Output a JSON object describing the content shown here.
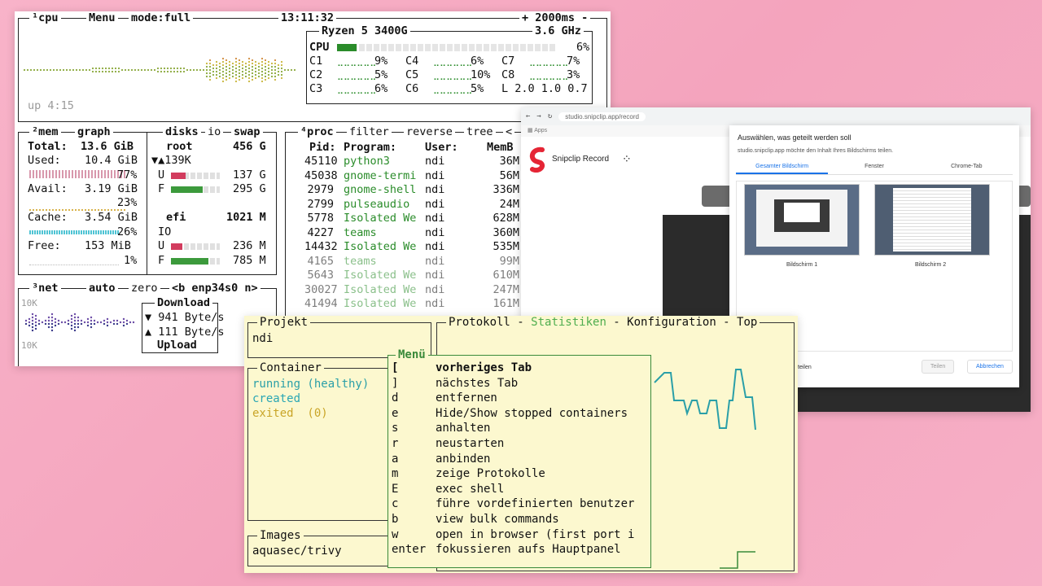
{
  "btop": {
    "cpu_box": {
      "title": "¹cpu",
      "menu": "Menu",
      "mode": "mode:full",
      "clock": "13:11:32",
      "rate": "+ 2000ms -",
      "uptime": "up 4:15",
      "cpu_name": "Ryzen 5 3400G",
      "freq": "3.6 GHz",
      "total_label": "CPU",
      "total_pct": "6%",
      "total_level": 0.06,
      "cores": [
        {
          "label": "C1",
          "pct": "9%"
        },
        {
          "label": "C2",
          "pct": "5%"
        },
        {
          "label": "C3",
          "pct": "6%"
        },
        {
          "label": "C4",
          "pct": "6%"
        },
        {
          "label": "C5",
          "pct": "10%"
        },
        {
          "label": "C6",
          "pct": "5%"
        },
        {
          "label": "C7",
          "pct": "7%"
        },
        {
          "label": "C8",
          "pct": "3%"
        }
      ],
      "load": "L 2.0 1.0 0.7"
    },
    "mem_box": {
      "title": "²mem",
      "graph_tab": "graph",
      "total": "Total:  13.6 GiB",
      "used_label": "Used:",
      "used_value": "10.4 GiB",
      "used_pct": "77%",
      "avail_label": "Avail:",
      "avail_value": "3.19 GiB",
      "avail_pct": "23%",
      "cache_label": "Cache:",
      "cache_value": "3.54 GiB",
      "cache_pct": "26%",
      "free_label": "Free:",
      "free_value": "153 MiB",
      "free_pct": "1%"
    },
    "disks_box": {
      "title": "disks",
      "io_tab": "io",
      "swap_tab": "swap",
      "root_name": "root",
      "root_size": "456 G",
      "root_io": "▼▲139K",
      "root_used_label": "U",
      "root_used": "137 G",
      "root_used_level": 0.3,
      "root_free_label": "F",
      "root_free": "295 G",
      "root_free_level": 0.65,
      "efi_name": "efi",
      "efi_size": "1021 M",
      "efi_io": "IO",
      "efi_used_label": "U",
      "efi_used": "236 M",
      "efi_used_level": 0.23,
      "efi_free_label": "F",
      "efi_free": "785 M",
      "efi_free_level": 0.77
    },
    "proc_box": {
      "title": "⁴proc",
      "filter_tab": "filter",
      "reverse_tab": "reverse",
      "tree_tab": "tree",
      "arrow": "<",
      "headers": {
        "pid": "Pid:",
        "program": "Program:",
        "user": "User:",
        "mem": "MemB"
      },
      "rows": [
        {
          "pid": "45110",
          "program": "python3",
          "user": "ndi",
          "mem": "36M"
        },
        {
          "pid": "45038",
          "program": "gnome-termi",
          "user": "ndi",
          "mem": "56M"
        },
        {
          "pid": "2979",
          "program": "gnome-shell",
          "user": "ndi",
          "mem": "336M"
        },
        {
          "pid": "2799",
          "program": "pulseaudio",
          "user": "ndi",
          "mem": "24M"
        },
        {
          "pid": "5778",
          "program": "Isolated We",
          "user": "ndi",
          "mem": "628M"
        },
        {
          "pid": "4227",
          "program": "teams",
          "user": "ndi",
          "mem": "360M"
        },
        {
          "pid": "14432",
          "program": "Isolated We",
          "user": "ndi",
          "mem": "535M"
        },
        {
          "pid": "4165",
          "program": "teams",
          "user": "ndi",
          "mem": "99M"
        },
        {
          "pid": "5643",
          "program": "Isolated We",
          "user": "ndi",
          "mem": "610M"
        },
        {
          "pid": "30027",
          "program": "Isolated We",
          "user": "ndi",
          "mem": "247M"
        },
        {
          "pid": "41494",
          "program": "Isolated We",
          "user": "ndi",
          "mem": "161M"
        }
      ]
    },
    "net_box": {
      "title": "³net",
      "auto_tab": "auto",
      "zero_tab": "zero",
      "iface": "<b enp34s0 n>",
      "scale_top": "10K",
      "scale_bottom": "10K",
      "download_label": "Download",
      "download_rate": "▼ 941 Byte/s",
      "upload_rate": "▲ 111 Byte/s",
      "upload_label": "Upload"
    }
  },
  "browser": {
    "url": "studio.snipclip.app/record",
    "bookmark": "Apps",
    "app_name": "Snipclip Record",
    "dialog": {
      "title": "Auswählen, was geteilt werden soll",
      "subtitle": "studio.snipclip.app möchte den Inhalt Ihres Bildschirms teilen.",
      "tabs": [
        "Gesamter Bildschirm",
        "Fenster",
        "Chrome-Tab"
      ],
      "screens": [
        "Bildschirm 1",
        "Bildschirm 2"
      ],
      "share_audio": "teilen",
      "share_button": "Teilen",
      "cancel_button": "Abbrechen"
    }
  },
  "lazydocker": {
    "project_title": "Projekt",
    "project_name": "ndi",
    "tabs_line": {
      "protokoll": "Protokoll",
      "statistiken": "Statistiken",
      "konfiguration": "Konfiguration",
      "top": "Top",
      "sep": " - "
    },
    "container_title": "Container",
    "containers": [
      {
        "text": "running (healthy)",
        "state": "running"
      },
      {
        "text": "created",
        "state": "created"
      },
      {
        "text": "exited  (0)",
        "state": "exited"
      }
    ],
    "images_title": "Images",
    "images": [
      "aquasec/trivy"
    ],
    "menu_title": "Menü",
    "menu_items": [
      {
        "key": "[",
        "label": "vorheriges Tab"
      },
      {
        "key": "]",
        "label": "nächstes Tab"
      },
      {
        "key": "d",
        "label": "entfernen"
      },
      {
        "key": "e",
        "label": "Hide/Show stopped containers"
      },
      {
        "key": "s",
        "label": "anhalten"
      },
      {
        "key": "r",
        "label": "neustarten"
      },
      {
        "key": "a",
        "label": "anbinden"
      },
      {
        "key": "m",
        "label": "zeige Protokolle"
      },
      {
        "key": "E",
        "label": "exec shell"
      },
      {
        "key": "c",
        "label": "führe vordefinierten benutzer"
      },
      {
        "key": "b",
        "label": "view bulk commands"
      },
      {
        "key": "w",
        "label": "open in browser (first port i"
      },
      {
        "key": "enter",
        "label": "fokussieren aufs Hauptpanel"
      }
    ]
  },
  "colors": {
    "green": "#2a8c2a",
    "teal": "#2a9fa8",
    "lazy_bg": "#fcf8cf",
    "accent_blue": "#1a73e8",
    "snip_red": "#e52535"
  }
}
